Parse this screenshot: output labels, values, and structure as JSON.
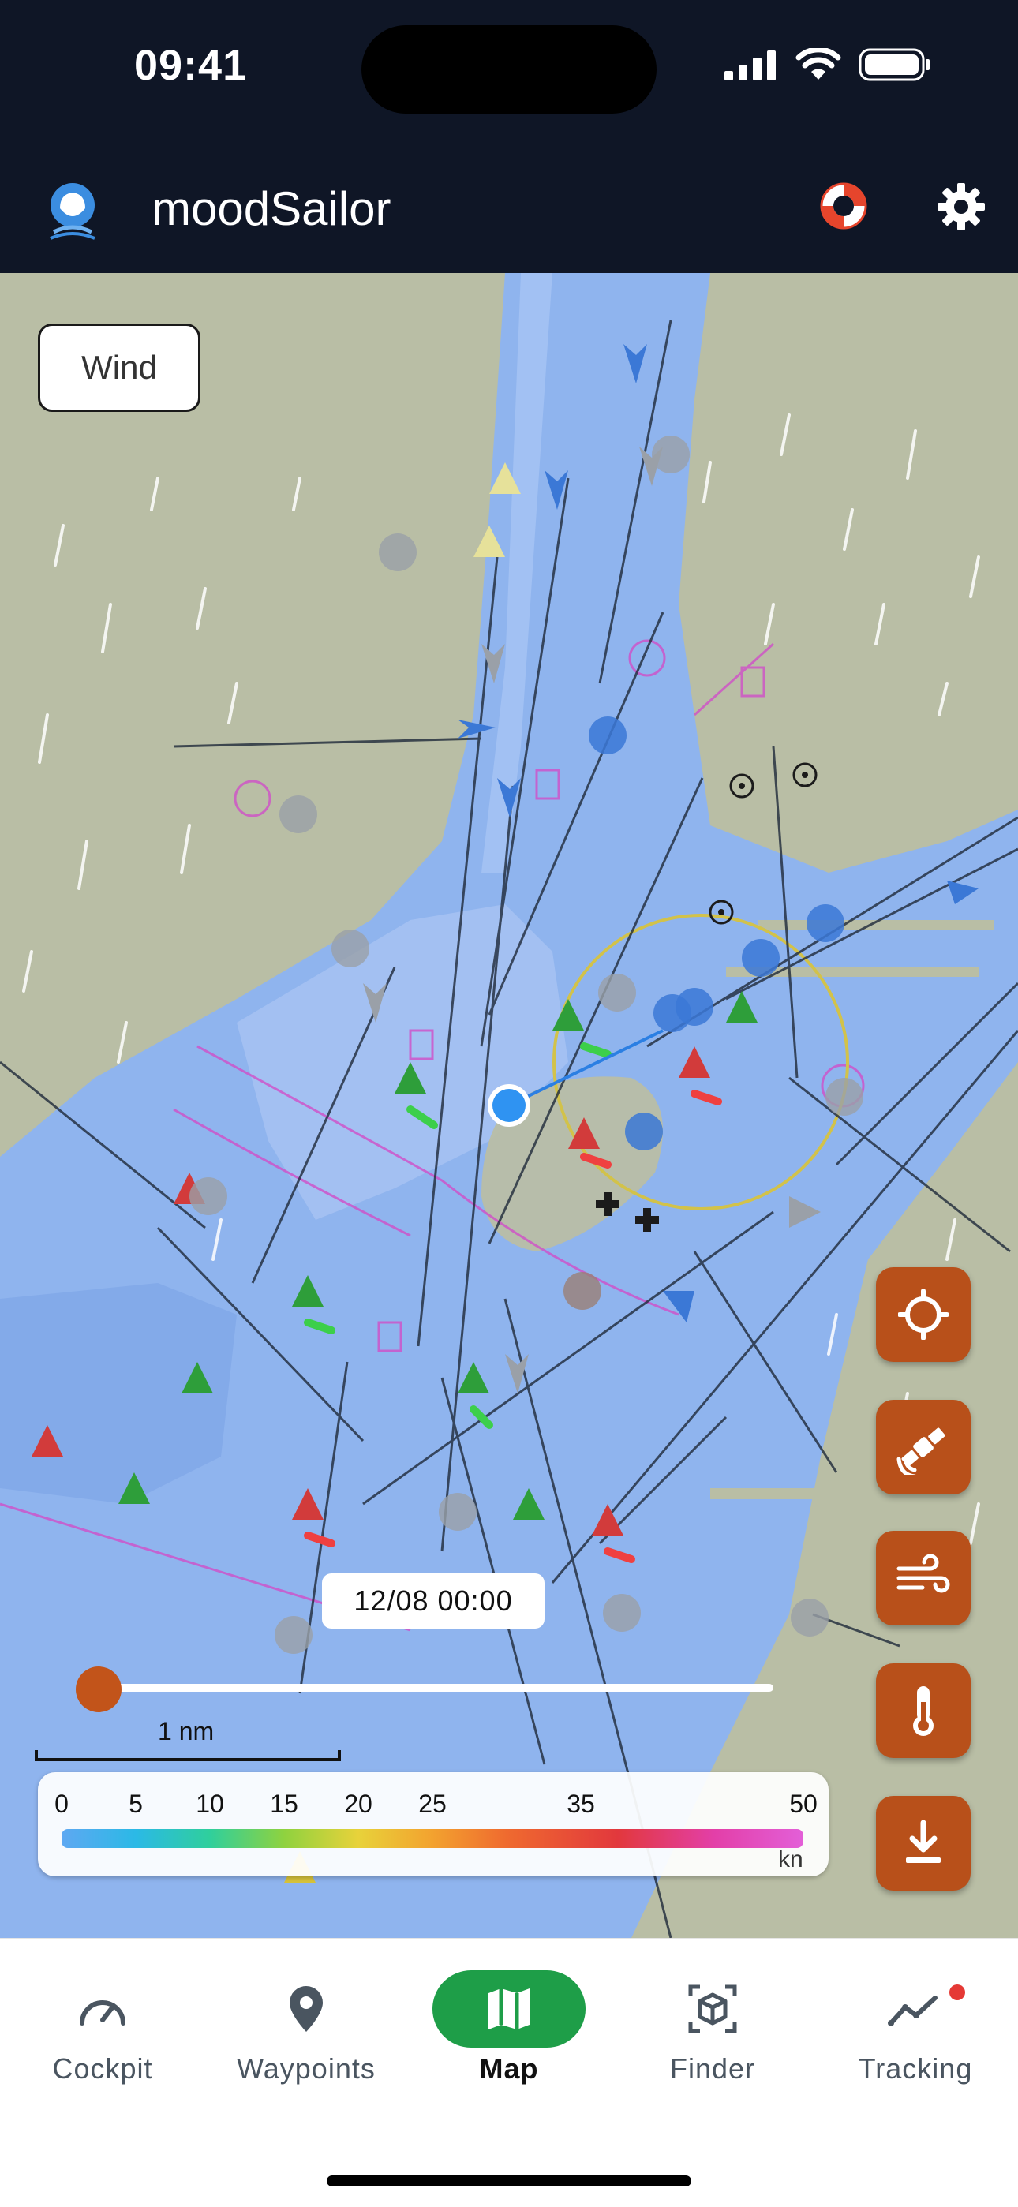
{
  "status_bar": {
    "time": "09:41"
  },
  "app": {
    "title": "moodSailor"
  },
  "map": {
    "layer_button": "Wind",
    "time_label": "12/08 00:00",
    "scale_label": "1 nm",
    "legend": {
      "ticks": [
        "0",
        "5",
        "10",
        "15",
        "20",
        "25",
        "35",
        "50"
      ],
      "unit": "kn"
    }
  },
  "fabs": [
    "crosshair-icon",
    "satellite-icon",
    "wind-icon",
    "thermometer-icon",
    "download-icon"
  ],
  "nav": {
    "items": [
      {
        "label": "Cockpit",
        "icon": "gauge-icon"
      },
      {
        "label": "Waypoints",
        "icon": "pin-icon"
      },
      {
        "label": "Map",
        "icon": "map-icon",
        "active": true
      },
      {
        "label": "Finder",
        "icon": "cube-scan-icon"
      },
      {
        "label": "Tracking",
        "icon": "trend-icon",
        "badge": true
      }
    ]
  },
  "colors": {
    "accent": "#b8501a",
    "nav_active": "#1e9e48",
    "header_bg": "#0f1626",
    "water": "#8fb4ee"
  }
}
